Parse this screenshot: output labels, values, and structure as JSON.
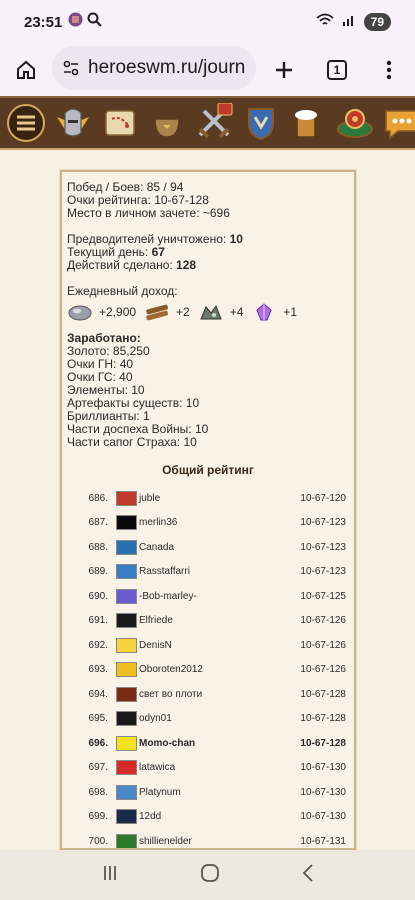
{
  "status": {
    "time": "23:51",
    "battery": "79"
  },
  "browser": {
    "url": "heroeswm.ru/journ",
    "tab_count": "1"
  },
  "stats": {
    "wins": "Побед / Боев: 85 / 94",
    "rating": "Очки рейтинга: 10-67-128",
    "place": "Место в личном зачете: ~696",
    "predators_label": "Предводителей уничтожено: ",
    "predators": "10",
    "day_label": "Текущий день: ",
    "day": "67",
    "actions_label": "Действий сделано: ",
    "actions": "128",
    "daily_income": "Ежедневный доход:",
    "income": [
      {
        "icon": "ore-icon",
        "amount": "+2,900"
      },
      {
        "icon": "wood-icon",
        "amount": "+2"
      },
      {
        "icon": "mercury-icon",
        "amount": "+4"
      },
      {
        "icon": "crystal-icon",
        "amount": "+1"
      }
    ],
    "earned_title": "Заработано:",
    "earned": [
      "Золото: 85,250",
      "Очки ГН: 40",
      "Очки ГС: 40",
      "Элементы: 10",
      "Артефакты существ: 10",
      "Бриллианты: 1",
      "Части доспеха Войны: 10",
      "Части сапог Страха: 10"
    ]
  },
  "rating": {
    "title": "Общий рейтинг",
    "rows": [
      {
        "pos": "686.",
        "nick": "juble",
        "score": "10-67-120",
        "color": "#c0392b"
      },
      {
        "pos": "687.",
        "nick": "merlin36",
        "score": "10-67-123",
        "color": "#0a0a0a"
      },
      {
        "pos": "688.",
        "nick": "Canada",
        "score": "10-67-123",
        "color": "#2a6fb0"
      },
      {
        "pos": "689.",
        "nick": "Rasstaffarri",
        "score": "10-67-123",
        "color": "#3b7dc4"
      },
      {
        "pos": "690.",
        "nick": "-Bob-marley-",
        "score": "10-67-125",
        "color": "#6a5acd"
      },
      {
        "pos": "691.",
        "nick": "Elfriede",
        "score": "10-67-126",
        "color": "#1a1a1a"
      },
      {
        "pos": "692.",
        "nick": "DenisN",
        "score": "10-67-126",
        "color": "#f5d33b"
      },
      {
        "pos": "693.",
        "nick": "Oboroten2012",
        "score": "10-67-126",
        "color": "#f0c020"
      },
      {
        "pos": "694.",
        "nick": "свет во плоти",
        "score": "10-67-128",
        "color": "#7a2a10"
      },
      {
        "pos": "695.",
        "nick": "odyn01",
        "score": "10-67-128",
        "color": "#1a1a1a"
      },
      {
        "pos": "696.",
        "nick": "Momo-chan",
        "score": "10-67-128",
        "color": "#f2e21c",
        "bold": true
      },
      {
        "pos": "697.",
        "nick": "latawica",
        "score": "10-67-130",
        "color": "#d62a2a"
      },
      {
        "pos": "698.",
        "nick": "Platynum",
        "score": "10-67-130",
        "color": "#4a88c8"
      },
      {
        "pos": "699.",
        "nick": "12dd",
        "score": "10-67-130",
        "color": "#1a2a4a"
      },
      {
        "pos": "700.",
        "nick": "shillienelder",
        "score": "10-67-131",
        "color": "#2a7a2a"
      }
    ]
  }
}
